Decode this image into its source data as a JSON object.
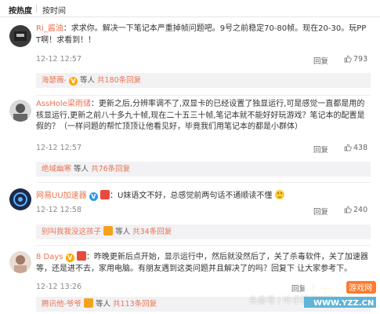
{
  "sort": {
    "hot": "按热度",
    "time": "按时间"
  },
  "comments": [
    {
      "username": "Ri_酱油",
      "text": "：求求你。解决一下笔记本严重掉帧问题吧。9号之前稳定70-80帧。现在20-30。玩PPT啊！求看到！！",
      "time": "12-12 12:57",
      "reply": "回复",
      "likes": "793",
      "sub_user": "海瑟薇-",
      "sub_text_1": "等人",
      "sub_count": "共180条回复"
    },
    {
      "username": "AssHole梁雨储",
      "text": "：更新之后,分辨率调不了,双显卡的已经设置了独显运行,可是感觉一直都是用的核显运行,更新之前八十多九十帧,现在二十五三十帧,笔记本就不能好好玩游戏？笔记本的配置是假的？（一样问题的帮忙顶顶让他看见好，毕竟我们用笔记本的都是小群体）",
      "time": "12-12 12:57",
      "reply": "回复",
      "likes": "438",
      "sub_user": "绝域幽寒",
      "sub_text_1": "等人",
      "sub_count": "共76条回复"
    },
    {
      "username": "网易UU加速器",
      "text": "：U妹语文不好，总感觉前两句话不通顺读不懂",
      "time": "12-12 12:58",
      "reply": "回复",
      "likes": "240",
      "sub_user": "别叫我我没这孩子",
      "sub_text_1": "等人",
      "sub_count": "共34条回复"
    },
    {
      "username": "8 Days",
      "text": "：昨晚更新后点开始，显示运行中，然后就没然后了，关了杀毒软件，关了加速器等，还是进不去，家用电脑。有朋友遇到这类问题并且解决了的吗？回复下 让大家参考下。",
      "time": "12-12 13:26",
      "reply": "回复",
      "likes": "",
      "sub_user": "腾讯他-爷爷",
      "sub_text_1": "等人",
      "sub_count": "共113条回复"
    }
  ],
  "watermark": "头条号 / 叶子猪游戏网",
  "logo": {
    "brand": "叶子猪",
    "sub": "游戏网",
    "url": "WWW.YZZ.CN"
  },
  "colors": {
    "accent": "#eb7350",
    "vip": "#ffa800",
    "verified": "#2c9aea"
  }
}
